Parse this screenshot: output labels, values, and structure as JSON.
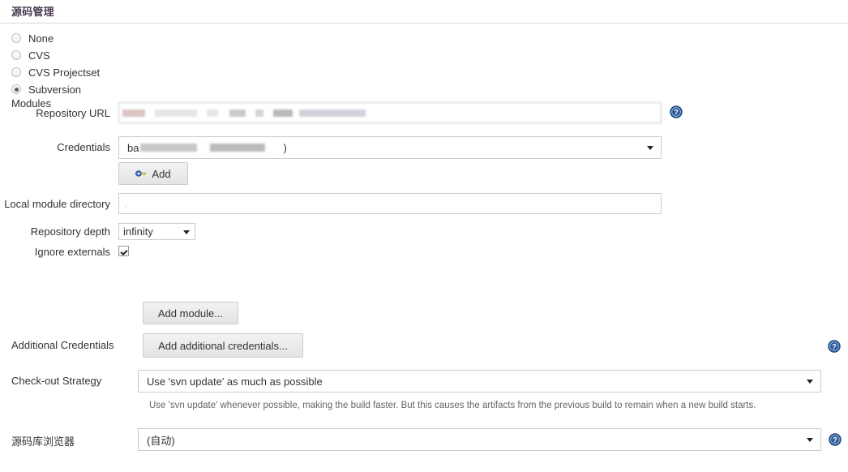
{
  "section": {
    "title": "源码管理"
  },
  "scm_options": [
    {
      "label": "None",
      "selected": false
    },
    {
      "label": "CVS",
      "selected": false
    },
    {
      "label": "CVS Projectset",
      "selected": false
    },
    {
      "label": "Subversion",
      "selected": true
    }
  ],
  "modules": {
    "label": "Modules",
    "repository_url": {
      "label": "Repository URL",
      "value": "",
      "redacted": true
    },
    "credentials": {
      "label": "Credentials",
      "value_prefix": "ba",
      "value_suffix": ")",
      "redacted": true
    },
    "add_credentials_button": {
      "label": "Add",
      "icon": "key-icon"
    },
    "local_module_directory": {
      "label": "Local module directory",
      "value": "."
    },
    "repository_depth": {
      "label": "Repository depth",
      "value": "infinity"
    },
    "ignore_externals": {
      "label": "Ignore externals",
      "checked": true
    },
    "add_module_button": {
      "label": "Add module..."
    }
  },
  "additional_credentials": {
    "label": "Additional Credentials",
    "button_label": "Add additional credentials..."
  },
  "checkout_strategy": {
    "label": "Check-out Strategy",
    "value": "Use 'svn update' as much as possible",
    "help_text": "Use 'svn update' whenever possible, making the build faster. But this causes the artifacts from the previous build to remain when a new build starts."
  },
  "repository_browser": {
    "label": "源码库浏览器",
    "value": "(自动)"
  },
  "colors": {
    "help_icon_blue": "#2a5c9a",
    "header_text": "#4a3b4f",
    "border": "#cccccc"
  },
  "icons": {
    "help": "help-icon",
    "caret_down": "chevron-down-icon"
  }
}
